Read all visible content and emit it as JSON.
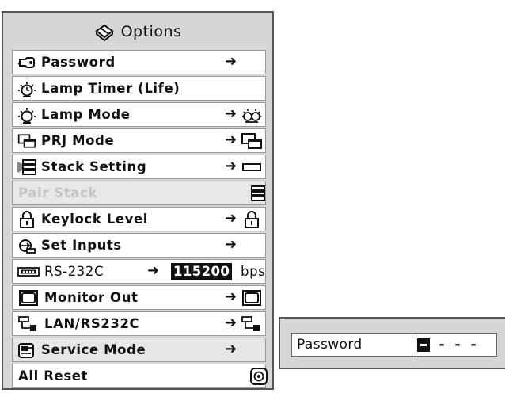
{
  "options": {
    "title": "Options",
    "title_icon": "toolbox-icon",
    "items": [
      {
        "label": "Password",
        "icon": "key-icon",
        "arrow": "➜",
        "trail_icon": ""
      },
      {
        "label": "Lamp Timer (Life)",
        "icon": "lamp-timer-icon",
        "arrow": "",
        "trail_icon": ""
      },
      {
        "label": "Lamp Mode",
        "icon": "lamp-mode-icon",
        "arrow": "➜",
        "trail_icon": "lamp-mode-double-icon"
      },
      {
        "label": "PRJ Mode",
        "icon": "prj-mode-icon",
        "arrow": "➜",
        "trail_icon": "prj-mode-icon"
      },
      {
        "label": "Stack Setting",
        "icon": "stack-setting-icon",
        "arrow": "➜",
        "trail_icon": "single-projector-icon"
      },
      {
        "label": "Pair Stack",
        "icon": "",
        "arrow": "",
        "trail_icon": "stacked-projectors-icon",
        "disabled": true
      },
      {
        "label": "Keylock Level",
        "icon": "padlock-icon",
        "arrow": "➜",
        "trail_icon": "padlock-icon"
      },
      {
        "label": "Set Inputs",
        "icon": "set-inputs-icon",
        "arrow": "➜",
        "trail_icon": ""
      },
      {
        "label": "RS-232C",
        "icon": "serial-port-icon",
        "arrow": "➜",
        "value": "115200",
        "unit": "bps"
      },
      {
        "label": "Monitor Out",
        "icon": "monitor-out-icon",
        "arrow": "➜",
        "trail_icon": "monitor-out-icon"
      },
      {
        "label": "LAN/RS232C",
        "icon": "network-icon",
        "arrow": "➜",
        "trail_icon": "network-icon"
      },
      {
        "label": "Service Mode",
        "icon": "service-mode-icon",
        "arrow": "➜",
        "trail_icon": "",
        "selected": true
      },
      {
        "label": "All Reset",
        "icon": "",
        "arrow": "",
        "trail_icon": "reset-icon"
      }
    ]
  },
  "password_dialog": {
    "label": "Password",
    "digits": [
      "-",
      "-",
      "-"
    ]
  }
}
